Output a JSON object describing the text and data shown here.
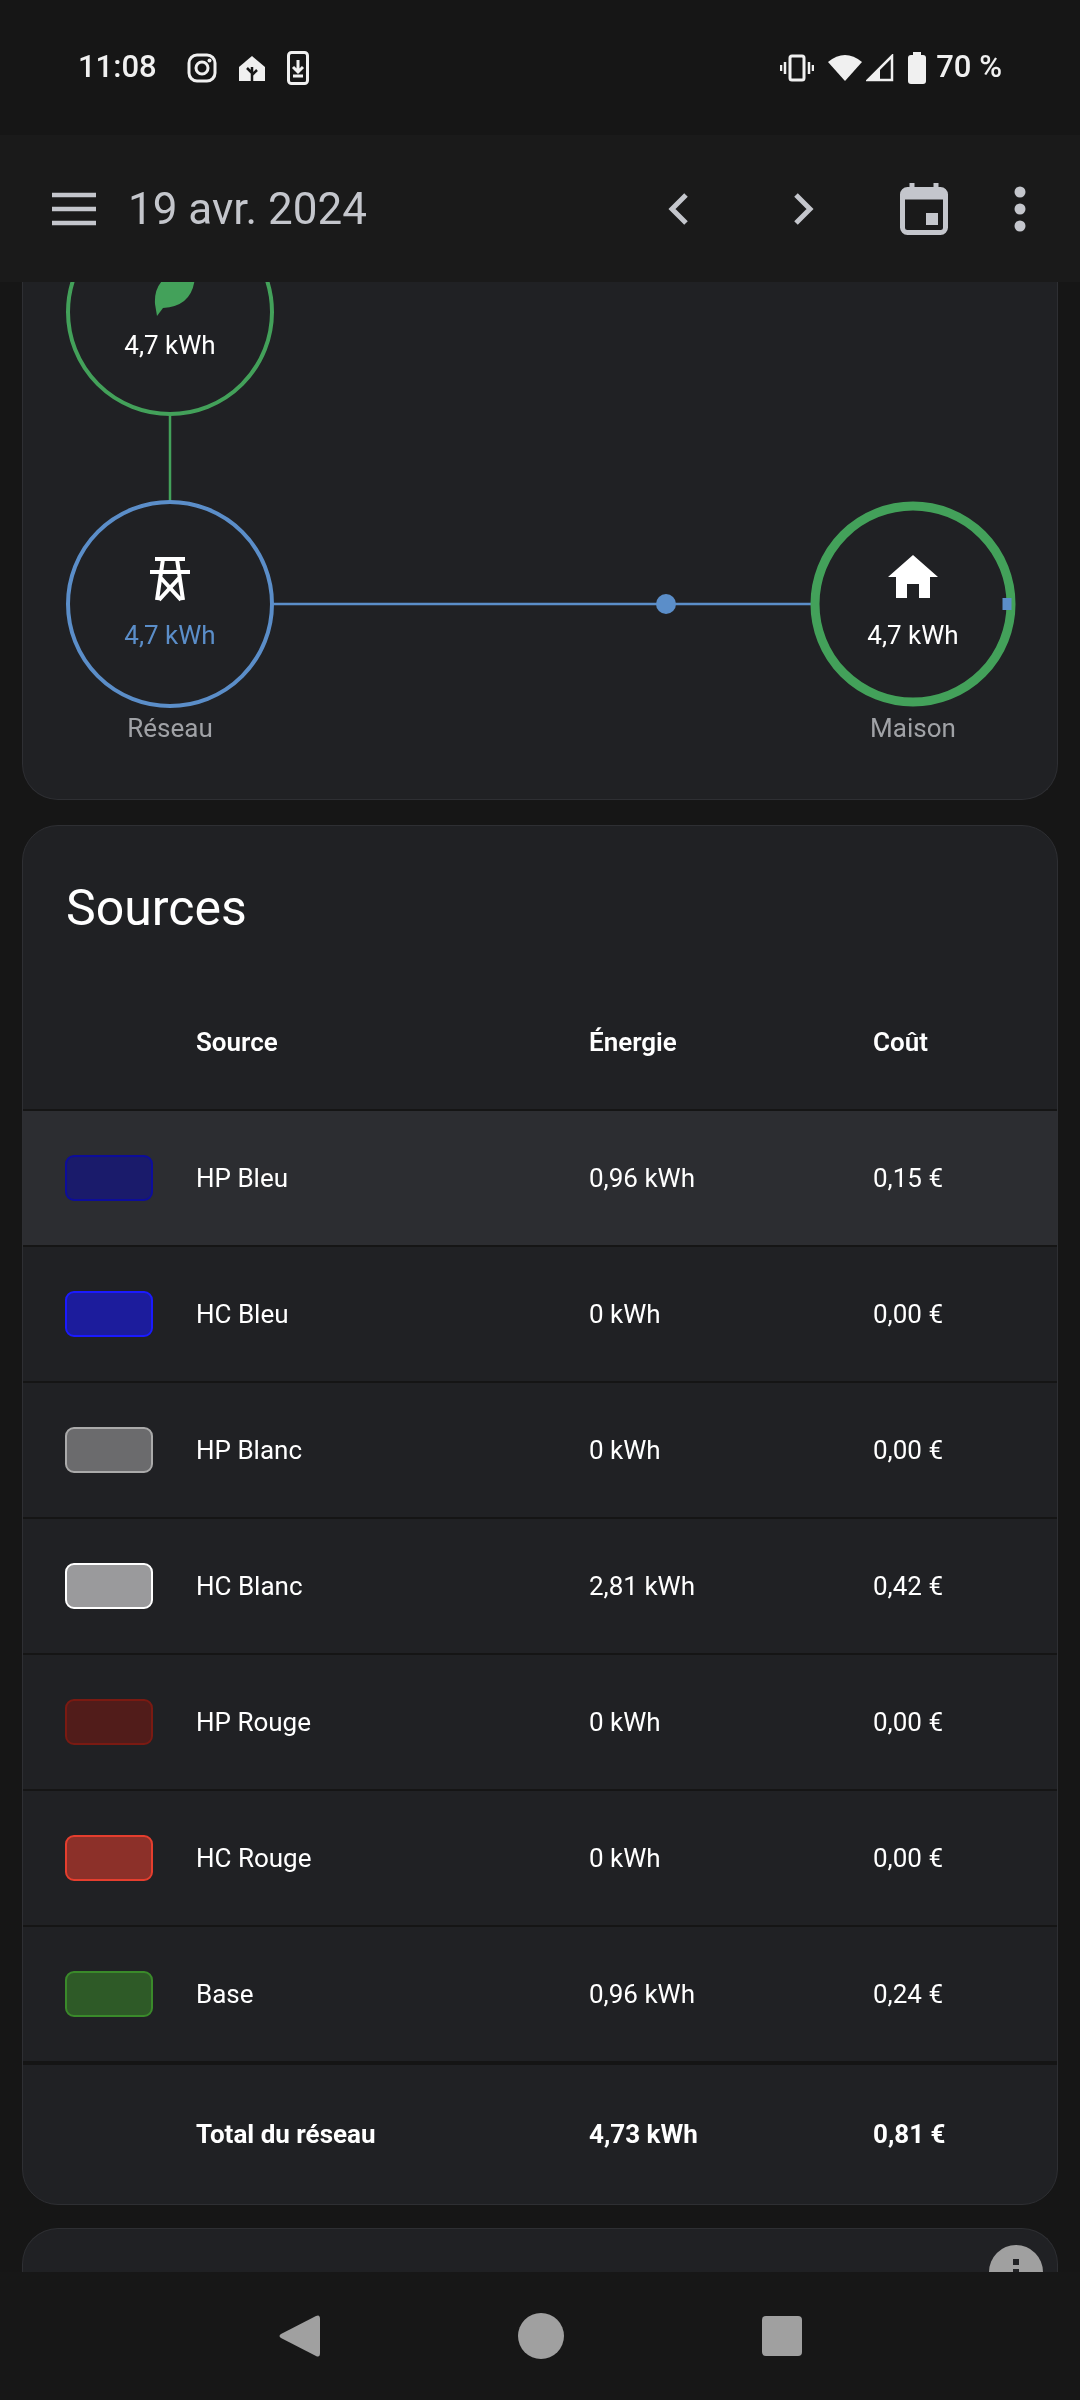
{
  "status_bar": {
    "time": "11:08",
    "battery": "70 %"
  },
  "app_bar": {
    "title": "19 avr. 2024"
  },
  "energy_flow": {
    "solar": {
      "value": "4,7 kWh"
    },
    "grid": {
      "value": "4,7 kWh",
      "label": "Réseau"
    },
    "home": {
      "value": "4,7 kWh",
      "label": "Maison"
    }
  },
  "sources": {
    "title": "Sources",
    "columns": [
      "Source",
      "Énergie",
      "Coût"
    ],
    "rows": [
      {
        "name": "HP Bleu",
        "energy": "0,96 kWh",
        "cost": "0,15 €",
        "color": "#0d0d9a",
        "highlighted": true
      },
      {
        "name": "HC Bleu",
        "energy": "0 kWh",
        "cost": "0,00 €",
        "color": "#1a1aff",
        "highlighted": false
      },
      {
        "name": "HP Blanc",
        "energy": "0 kWh",
        "cost": "0,00 €",
        "color": "#aaaaaa",
        "highlighted": false
      },
      {
        "name": "HC Blanc",
        "energy": "2,81 kWh",
        "cost": "0,42 €",
        "color": "#ffffff",
        "highlighted": false
      },
      {
        "name": "HP Rouge",
        "energy": "0 kWh",
        "cost": "0,00 €",
        "color": "#7a1a12",
        "highlighted": false
      },
      {
        "name": "HC Rouge",
        "energy": "0 kWh",
        "cost": "0,00 €",
        "color": "#e53e2e",
        "highlighted": false
      },
      {
        "name": "Base",
        "energy": "0,96 kWh",
        "cost": "0,24 €",
        "color": "#3a8a2a",
        "highlighted": false
      }
    ],
    "total": {
      "label": "Total du réseau",
      "energy": "4,73 kWh",
      "cost": "0,81 €"
    }
  }
}
